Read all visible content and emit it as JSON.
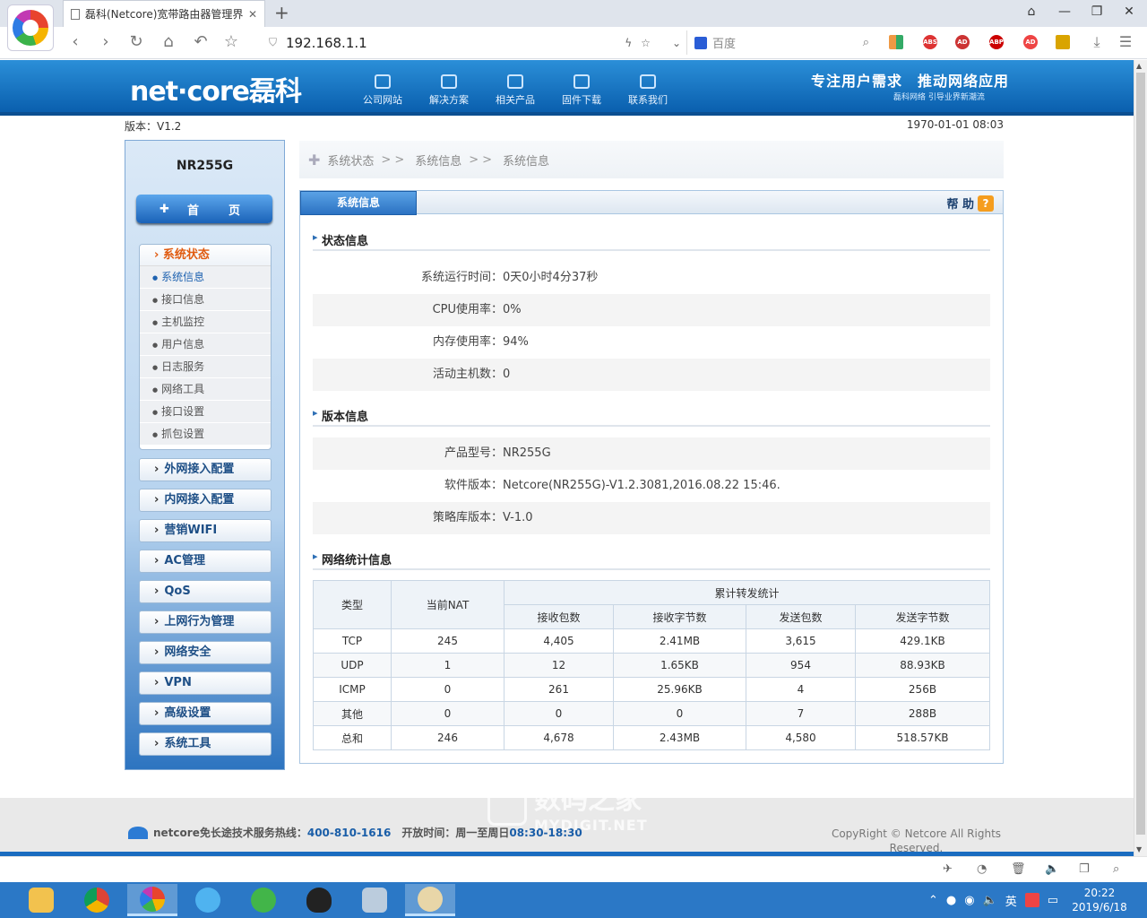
{
  "browser": {
    "tab_title": "磊科(Netcore)宽带路由器管理界面",
    "url": "192.168.1.1",
    "search_placeholder": "百度"
  },
  "header": {
    "logo": "net·core磊科",
    "nav": [
      "公司网站",
      "解决方案",
      "相关产品",
      "固件下载",
      "联系我们"
    ],
    "slogan": "专注用户需求　推动网络应用",
    "slogan_sub": "磊科网络 引导业界新潮流"
  },
  "topbar": {
    "version": "版本：V1.2",
    "datetime": "1970-01-01 08:03"
  },
  "sidebar": {
    "device": "NR255G",
    "home": "首　页",
    "submenu_title": "系统状态",
    "submenu_items": [
      "系统信息",
      "接口信息",
      "主机监控",
      "用户信息",
      "日志服务",
      "网络工具",
      "接口设置",
      "抓包设置"
    ],
    "menus": [
      "外网接入配置",
      "内网接入配置",
      "营销WIFI",
      "AC管理",
      "QoS",
      "上网行为管理",
      "网络安全",
      "VPN",
      "高级设置",
      "系统工具"
    ]
  },
  "breadcrumb": [
    "系统状态",
    ">>",
    "系统信息",
    ">>",
    "系统信息"
  ],
  "panel": {
    "tab": "系统信息",
    "help": "帮 助",
    "status_title": "状态信息",
    "status": [
      {
        "k": "系统运行时间：",
        "v": "0天0小时4分37秒"
      },
      {
        "k": "CPU使用率：",
        "v": "0%"
      },
      {
        "k": "内存使用率：",
        "v": "94%"
      },
      {
        "k": "活动主机数：",
        "v": "0"
      }
    ],
    "version_title": "版本信息",
    "version": [
      {
        "k": "产品型号：",
        "v": "NR255G"
      },
      {
        "k": "软件版本：",
        "v": "Netcore(NR255G)-V1.2.3081,2016.08.22 15:46."
      },
      {
        "k": "策略库版本：",
        "v": "V-1.0"
      }
    ],
    "net_title": "网络统计信息",
    "table": {
      "h_type": "类型",
      "h_nat": "当前NAT",
      "h_group": "累计转发统计",
      "h_cols": [
        "接收包数",
        "接收字节数",
        "发送包数",
        "发送字节数"
      ],
      "rows": [
        [
          "TCP",
          "245",
          "4,405",
          "2.41MB",
          "3,615",
          "429.1KB"
        ],
        [
          "UDP",
          "1",
          "12",
          "1.65KB",
          "954",
          "88.93KB"
        ],
        [
          "ICMP",
          "0",
          "261",
          "25.96KB",
          "4",
          "256B"
        ],
        [
          "其他",
          "0",
          "0",
          "0",
          "7",
          "288B"
        ],
        [
          "总和",
          "246",
          "4,678",
          "2.43MB",
          "4,580",
          "518.57KB"
        ]
      ]
    }
  },
  "footer": {
    "brand": "netcore",
    "hotline_label": "免长途技术服务热线：",
    "hotline": "400-810-1616",
    "hours_label": "开放时间：周一至周日",
    "hours": "08:30-18:30",
    "copyright": "CopyRight © Netcore All Rights Reserved."
  },
  "watermark": {
    "cn": "数码之家",
    "en": "MYDIGIT.NET"
  },
  "taskbar": {
    "ime": "英",
    "time": "20:22",
    "date": "2019/6/18"
  }
}
